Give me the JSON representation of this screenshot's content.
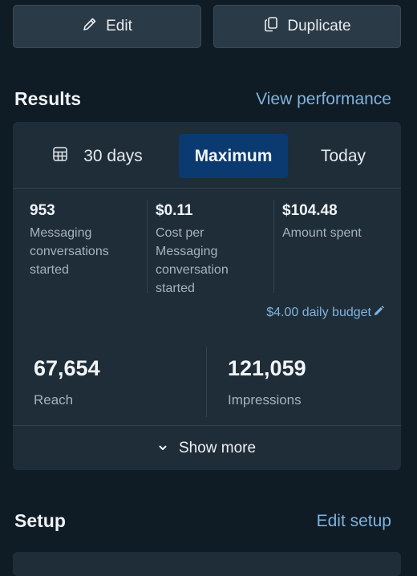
{
  "actions": {
    "edit_label": "Edit",
    "duplicate_label": "Duplicate"
  },
  "results": {
    "title": "Results",
    "view_link": "View performance",
    "tabs": [
      {
        "label": "30 days",
        "icon": "calendar-icon"
      },
      {
        "label": "Maximum",
        "selected": true
      },
      {
        "label": "Today"
      }
    ],
    "stats": [
      {
        "value": "953",
        "label": "Messaging conversations started"
      },
      {
        "value": "$0.11",
        "label": "Cost per Messaging conversation started"
      },
      {
        "value": "$104.48",
        "label": "Amount spent"
      }
    ],
    "budget": "$4.00 daily budget",
    "big_stats": [
      {
        "value": "67,654",
        "label": "Reach"
      },
      {
        "value": "121,059",
        "label": "Impressions"
      }
    ],
    "show_more": "Show more"
  },
  "setup": {
    "title": "Setup",
    "edit_link": "Edit setup"
  },
  "colors": {
    "background": "#0f1b25",
    "card": "#1f2d39",
    "accent_link": "#7fb3dd",
    "selected_tab": "#0b3a70"
  }
}
